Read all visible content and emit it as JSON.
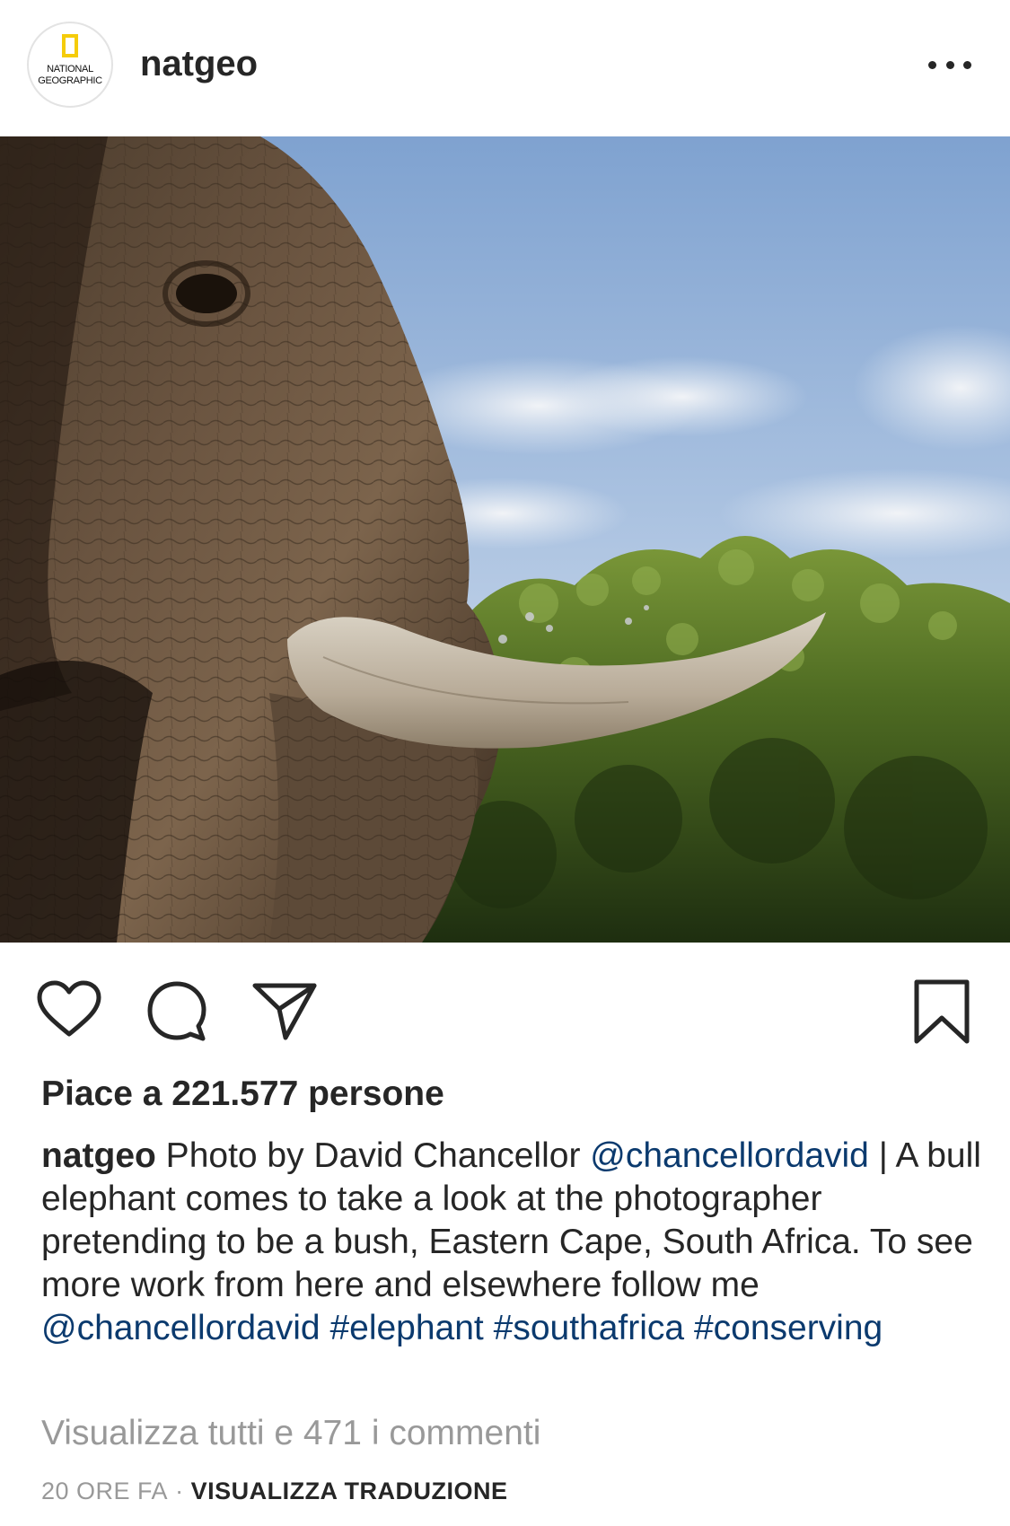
{
  "post": {
    "username": "natgeo",
    "avatar": {
      "brand_line_1": "NATIONAL",
      "brand_line_2": "GEOGRAPHIC",
      "accent": "#f5cc0a"
    },
    "more_icon": "more-horizontal-icon",
    "photo_alt": "Close-up of an elephant's head and tusk against a blue sky and green bush",
    "actions": {
      "like_icon": "heart-icon",
      "comment_icon": "comment-bubble-icon",
      "share_icon": "paper-plane-icon",
      "save_icon": "bookmark-icon"
    },
    "likes_text": "Piace a 221.577 persone",
    "caption": {
      "user": "natgeo",
      "text_1": " Photo by David Chancellor ",
      "mention_1": "@chancellordavid",
      "text_2": " | A bull elephant comes to take a look at the photographer pretending to be a bush, Eastern Cape, South Africa. To see more work from here and elsewhere follow me ",
      "mention_2": "@chancellordavid",
      "text_3": " ",
      "hashtag_1": "#elephant",
      "text_4": " ",
      "hashtag_2": "#southafrica",
      "text_5": " ",
      "hashtag_3": "#conserving"
    },
    "view_comments": "Visualizza tutti e 471 i commenti",
    "time": "20 ORE FA",
    "separator": "·",
    "translate": "VISUALIZZA TRADUZIONE"
  },
  "colors": {
    "text": "#262626",
    "link": "#0b3a6e",
    "muted": "#999999",
    "brand_yellow": "#f5cc0a"
  }
}
